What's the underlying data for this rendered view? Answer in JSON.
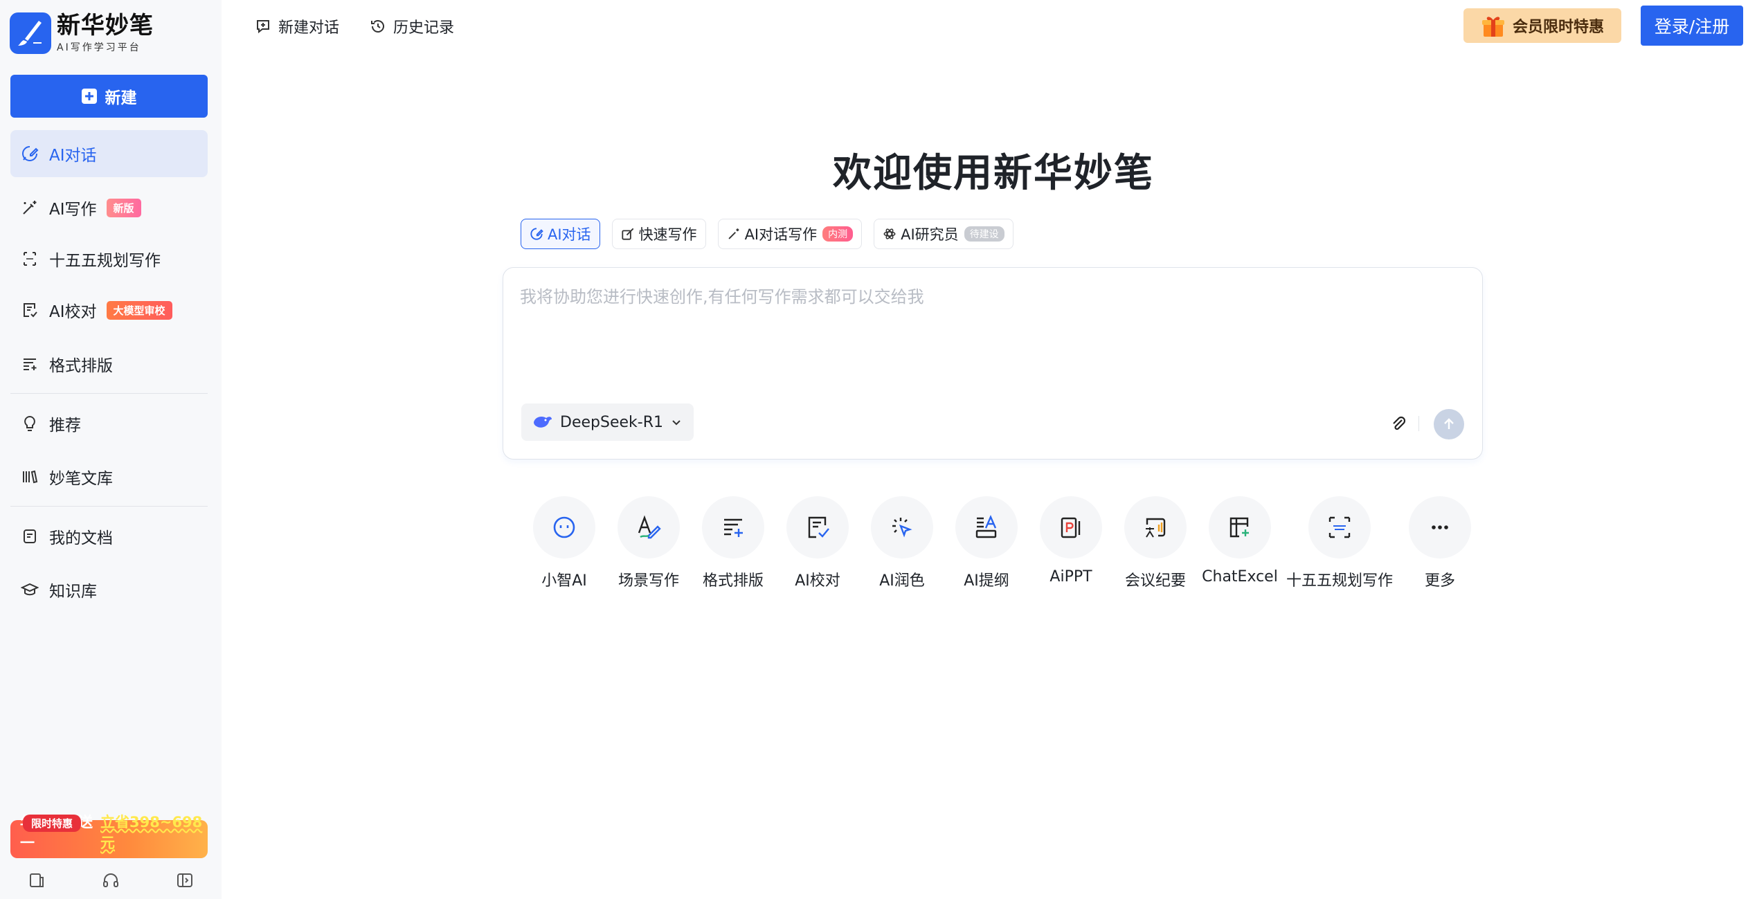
{
  "brand": {
    "title": "新华妙笔",
    "subtitle": "AI写作学习平台"
  },
  "sidebar": {
    "new_button": "新建",
    "items": [
      {
        "label": "AI对话",
        "icon": "chat-edit-icon",
        "active": true
      },
      {
        "label": "AI写作",
        "icon": "magic-pen-icon",
        "tag": "新版"
      },
      {
        "label": "十五五规划写作",
        "icon": "plan-doc-icon"
      },
      {
        "label": "AI校对",
        "icon": "proofread-icon",
        "tag": "大模型审校"
      },
      {
        "label": "格式排版",
        "icon": "format-icon"
      },
      {
        "label": "推荐",
        "icon": "lightbulb-icon"
      },
      {
        "label": "妙笔文库",
        "icon": "library-icon"
      },
      {
        "label": "我的文档",
        "icon": "my-docs-icon"
      },
      {
        "label": "知识库",
        "icon": "knowledge-icon"
      }
    ],
    "promo": {
      "badge": "限时特惠",
      "text": "年卡买一送一",
      "highlight": "立省398~698元"
    },
    "bottom_icons": [
      "mobile-icon",
      "headset-icon",
      "collapse-sidebar-icon"
    ]
  },
  "topbar": {
    "new_chat": "新建对话",
    "history": "历史记录",
    "vip": "会员限时特惠",
    "login": "登录/注册"
  },
  "main": {
    "welcome": "欢迎使用新华妙笔",
    "tabs": [
      {
        "label": "AI对话",
        "active": true
      },
      {
        "label": "快速写作"
      },
      {
        "label": "AI对话写作",
        "pill": "内测"
      },
      {
        "label": "AI研究员",
        "pill": "待建设"
      }
    ],
    "composer": {
      "placeholder": "我将协助您进行快速创作,有任何写作需求都可以交给我",
      "model": "DeepSeek-R1"
    },
    "tools": [
      {
        "label": "小智AI",
        "icon": "robot-face-icon"
      },
      {
        "label": "场景写作",
        "icon": "scene-writing-icon"
      },
      {
        "label": "格式排版",
        "icon": "format-sparkle-icon"
      },
      {
        "label": "AI校对",
        "icon": "proofread-check-icon"
      },
      {
        "label": "AI润色",
        "icon": "polish-cursor-icon"
      },
      {
        "label": "AI提纲",
        "icon": "outline-icon"
      },
      {
        "label": "AiPPT",
        "icon": "ppt-icon"
      },
      {
        "label": "会议纪要",
        "icon": "meeting-notes-icon"
      },
      {
        "label": "ChatExcel",
        "icon": "excel-table-icon"
      },
      {
        "label": "十五五规划写作",
        "icon": "plan-writing-icon"
      },
      {
        "label": "更多",
        "icon": "more-dots-icon"
      }
    ]
  },
  "colors": {
    "primary": "#2864ef",
    "sidebar_bg": "#f7f8fa",
    "active_bg": "#e3e9f9",
    "vip_bg": "#fbd8a7"
  }
}
